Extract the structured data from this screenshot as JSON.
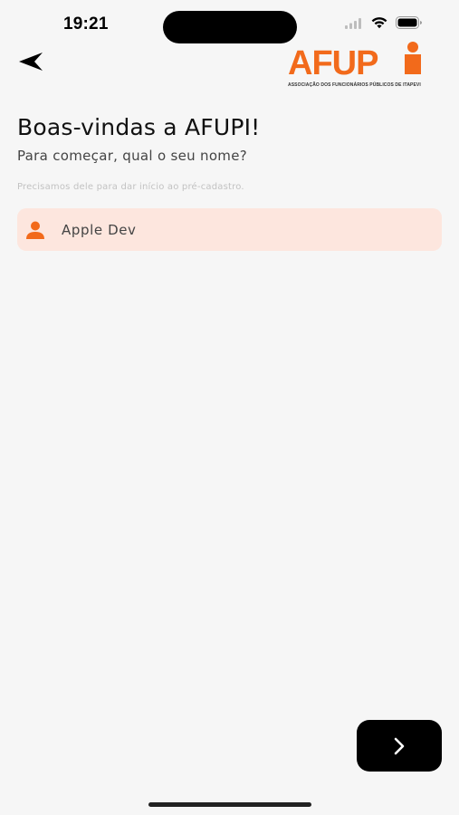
{
  "status_bar": {
    "time": "19:21",
    "icons": [
      "signal-icon",
      "wifi-icon",
      "battery-icon"
    ]
  },
  "header": {
    "back_icon": "back-arrow-icon",
    "logo": {
      "text": "AFUPI",
      "tagline": "ASSOCIAÇÃO DOS FUNCIONÁRIOS PÚBLICOS DE ITAPEVI",
      "brand_color": "#f26a1b"
    }
  },
  "content": {
    "title": "Boas-vindas a AFUPI!",
    "subtitle": "Para começar, qual o seu nome?",
    "hint": "Precisamos dele para dar início ao pré-cadastro."
  },
  "name_field": {
    "icon": "user-icon",
    "value": "Apple Dev",
    "background": "#fde6de",
    "icon_color": "#f26a1b"
  },
  "next_button": {
    "icon": "chevron-right-icon"
  }
}
